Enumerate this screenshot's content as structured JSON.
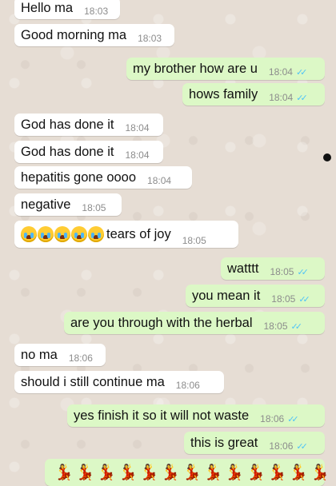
{
  "messages": [
    {
      "id": "m1",
      "dir": "in",
      "text": "Hello ma",
      "time": "18:03"
    },
    {
      "id": "m2",
      "dir": "in",
      "text": "Good morning ma",
      "time": "18:03"
    },
    {
      "id": "m3",
      "dir": "out",
      "text": "my brother how are u",
      "time": "18:04"
    },
    {
      "id": "m4",
      "dir": "out",
      "text": "hows family",
      "time": "18:04"
    },
    {
      "id": "m5",
      "dir": "in",
      "text": "God has done it",
      "time": "18:04"
    },
    {
      "id": "m6",
      "dir": "in",
      "text": "God has done it",
      "time": "18:04"
    },
    {
      "id": "m7",
      "dir": "in",
      "text": "hepatitis gone oooo",
      "time": "18:04"
    },
    {
      "id": "m8",
      "dir": "in",
      "text": "negative",
      "time": "18:05"
    },
    {
      "id": "m9",
      "dir": "in",
      "text": "tears of joy",
      "time": "18:05",
      "emoji": "loudly-crying-face",
      "emoji_count": 5
    },
    {
      "id": "m10",
      "dir": "out",
      "text": "watttt",
      "time": "18:05"
    },
    {
      "id": "m11",
      "dir": "out",
      "text": "you mean it",
      "time": "18:05"
    },
    {
      "id": "m12",
      "dir": "out",
      "text": "are you through with the herbal",
      "time": "18:05"
    },
    {
      "id": "m13",
      "dir": "in",
      "text": "no ma",
      "time": "18:06"
    },
    {
      "id": "m14",
      "dir": "in",
      "text": "should i still continue ma",
      "time": "18:06"
    },
    {
      "id": "m15",
      "dir": "out",
      "text": "yes finish it so it will not waste",
      "time": "18:06"
    },
    {
      "id": "m16",
      "dir": "out",
      "text": "this is great",
      "time": "18:06"
    },
    {
      "id": "m17",
      "dir": "out",
      "text": "",
      "emoji": "dancer",
      "emoji_count": 13
    }
  ],
  "read_ticks": "✓✓",
  "dancer_glyph": "💃",
  "colors": {
    "incoming": "#ffffff",
    "outgoing": "#dcf8c6",
    "ticks": "#4fc3f7",
    "background": "#e6ddd4"
  }
}
